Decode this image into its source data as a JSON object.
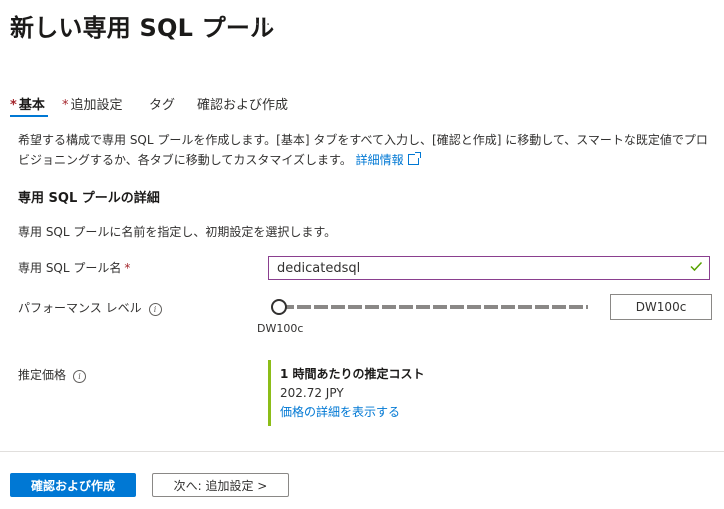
{
  "page": {
    "title": "新しい専用 SQL プール",
    "more_label": "..."
  },
  "tabs": [
    {
      "label": "基本",
      "required": true,
      "active": true
    },
    {
      "label": "追加設定",
      "required": true,
      "active": false
    },
    {
      "label": "タグ",
      "required": false,
      "active": false
    },
    {
      "label": "確認および作成",
      "required": false,
      "active": false
    }
  ],
  "required_marker": "*",
  "intro": {
    "text": "希望する構成で専用 SQL プールを作成します。[基本] タブをすべて入力し、[確認と作成] に移動して、スマートな既定値でプロビジョニングするか、各タブに移動してカスタマイズします。",
    "link_label": "詳細情報"
  },
  "section": {
    "title": "専用 SQL プールの詳細",
    "description": "専用 SQL プールに名前を指定し、初期設定を選択します。"
  },
  "form": {
    "name_label": "専用 SQL プール名",
    "name_value": "dedicatedsql",
    "performance_label": "パフォーマンス レベル",
    "performance_slider_value_label": "DW100c",
    "performance_slider_position": 0,
    "performance_box_value": "DW100c",
    "price_label": "推定価格",
    "price_title": "1 時間あたりの推定コスト",
    "price_value": "202.72 JPY",
    "price_link": "価格の詳細を表示する"
  },
  "footer": {
    "primary_button": "確認および作成",
    "next_button": "次へ: 追加設定 >"
  },
  "colors": {
    "accent": "#0078d4",
    "required": "#a4262c",
    "price_bar": "#8cbd18",
    "input_border": "#8a3f8f",
    "valid_check": "#57a300"
  },
  "icons": {
    "more": "ellipsis-icon",
    "external_link": "external-link-icon",
    "info": "info-icon",
    "valid": "check-icon"
  }
}
